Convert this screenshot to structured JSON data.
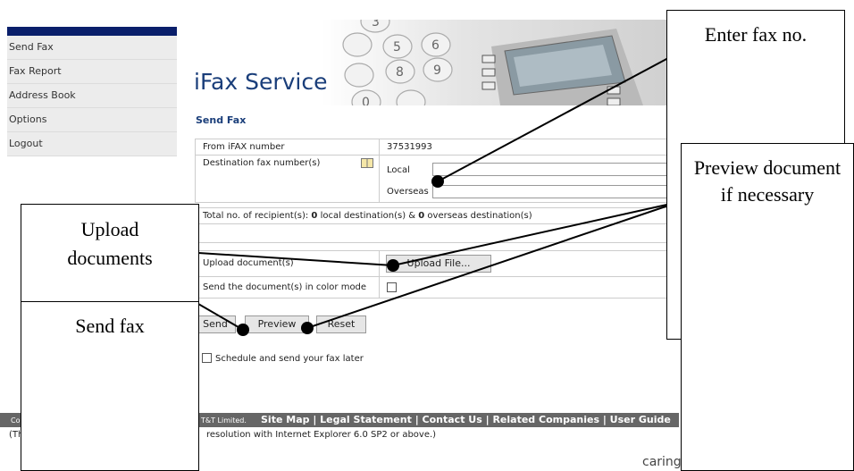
{
  "sidebar": {
    "items": [
      {
        "label": "Send Fax"
      },
      {
        "label": "Fax Report"
      },
      {
        "label": "Address Book"
      },
      {
        "label": "Options"
      },
      {
        "label": "Logout"
      }
    ]
  },
  "header": {
    "app_title": "iFax Service"
  },
  "banner": {
    "keys": [
      "3",
      "5",
      "6",
      "8",
      "9",
      "0"
    ]
  },
  "page": {
    "section_title": "Send Fax"
  },
  "form": {
    "from_label": "From iFAX number",
    "from_value": "37531993",
    "dest_label": "Destination fax number(s)",
    "local_label": "Local",
    "overseas_label": "Overseas",
    "recipients_prefix": "Total no. of recipient(s):",
    "local_count": "0",
    "local_text": "local destination(s)  &",
    "overseas_count": "0",
    "overseas_text": "overseas destination(s)",
    "upload_label": "Upload document(s)",
    "upload_button": "Upload File...",
    "color_label": "Send the document(s) in color mode",
    "send_button": "Send",
    "preview_button": "Preview",
    "reset_button": "Reset",
    "schedule_label": "Schedule and send your fax later"
  },
  "footer": {
    "copyright_start": "Co",
    "copyright_end": "T&T Limited.",
    "links": "Site Map | Legal Statement | Contact Us | Related Companies | User Guide",
    "note_start": "(Th",
    "note": "resolution with Internet Explorer 6.0 SP2 or above.)",
    "tagline": "caring"
  },
  "callouts": {
    "enter_fax": "Enter fax no.",
    "preview": "Preview document if necessary",
    "upload": "Upload documents",
    "send": "Send fax"
  }
}
